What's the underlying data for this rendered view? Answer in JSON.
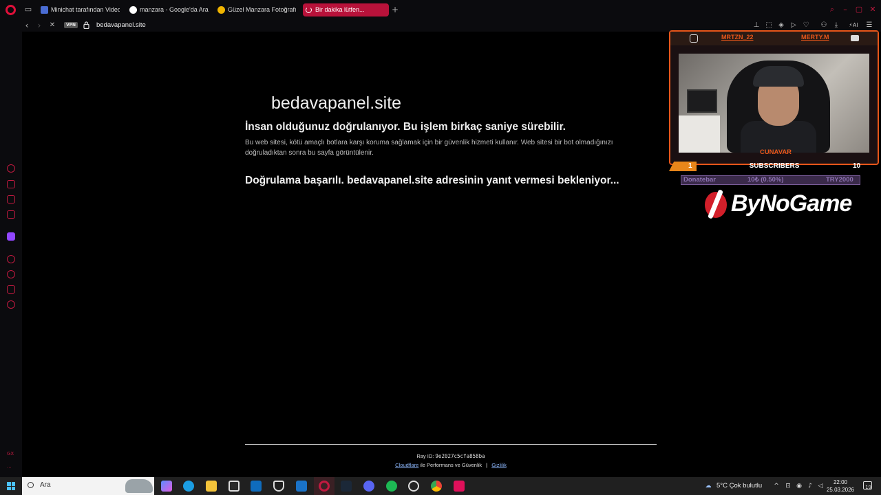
{
  "browser": {
    "tabs": [
      {
        "label": "Minichat tarafından Video",
        "favicon_color": "#4a6cd4"
      },
      {
        "label": "manzara - Google'da Ara",
        "favicon_color": "#ffffff"
      },
      {
        "label": "Güzel Manzara Fotoğrafı G",
        "favicon_color": "#f0b400"
      },
      {
        "label": "Bir dakika lütfen...",
        "active": true
      }
    ],
    "address": {
      "vpn_label": "VPN",
      "url": "bedavapanel.site"
    },
    "accent_color": "#b8123a"
  },
  "page": {
    "site_title": "bedavapanel.site",
    "heading": "İnsan olduğunuz doğrulanıyor. Bu işlem birkaç saniye sürebilir.",
    "description": "Bu web sitesi, kötü amaçlı botlara karşı koruma sağlamak için bir güvenlik hizmeti kullanır. Web sitesi bir bot olmadığınızı doğruladıktan sonra bu sayfa görüntülenir.",
    "status": "Doğrulama başarılı. bedavapanel.site adresinin yanıt vermesi bekleniyor...",
    "footer": {
      "ray_label": "Ray ID:",
      "ray_id": "9e2027c5cfa858ba",
      "cloudflare_link": "Cloudflare",
      "performance_text": "ile Performans ve Güvenlik",
      "separator": "|",
      "privacy_link": "Gizlilik"
    }
  },
  "overlay": {
    "instagram_handle": "MRTZN_22",
    "youtube_handle": "MERTY.M",
    "streamer_name": "CUNAVAR",
    "subscribers_label": "SUBSCRIBERS",
    "subscribers_current": "1",
    "subscribers_goal": "10",
    "donate_label": "Donatebar",
    "donate_progress": "10₺ (0.50%)",
    "donate_goal": "TRY2000",
    "sponsor_logo_text": "ByNoGame",
    "frame_color": "#e8561a"
  },
  "taskbar": {
    "search_placeholder": "Ara",
    "weather": "5°C  Çok bulutlu",
    "time": "22:00",
    "date": "25.03.2026",
    "notification_count": "19"
  }
}
